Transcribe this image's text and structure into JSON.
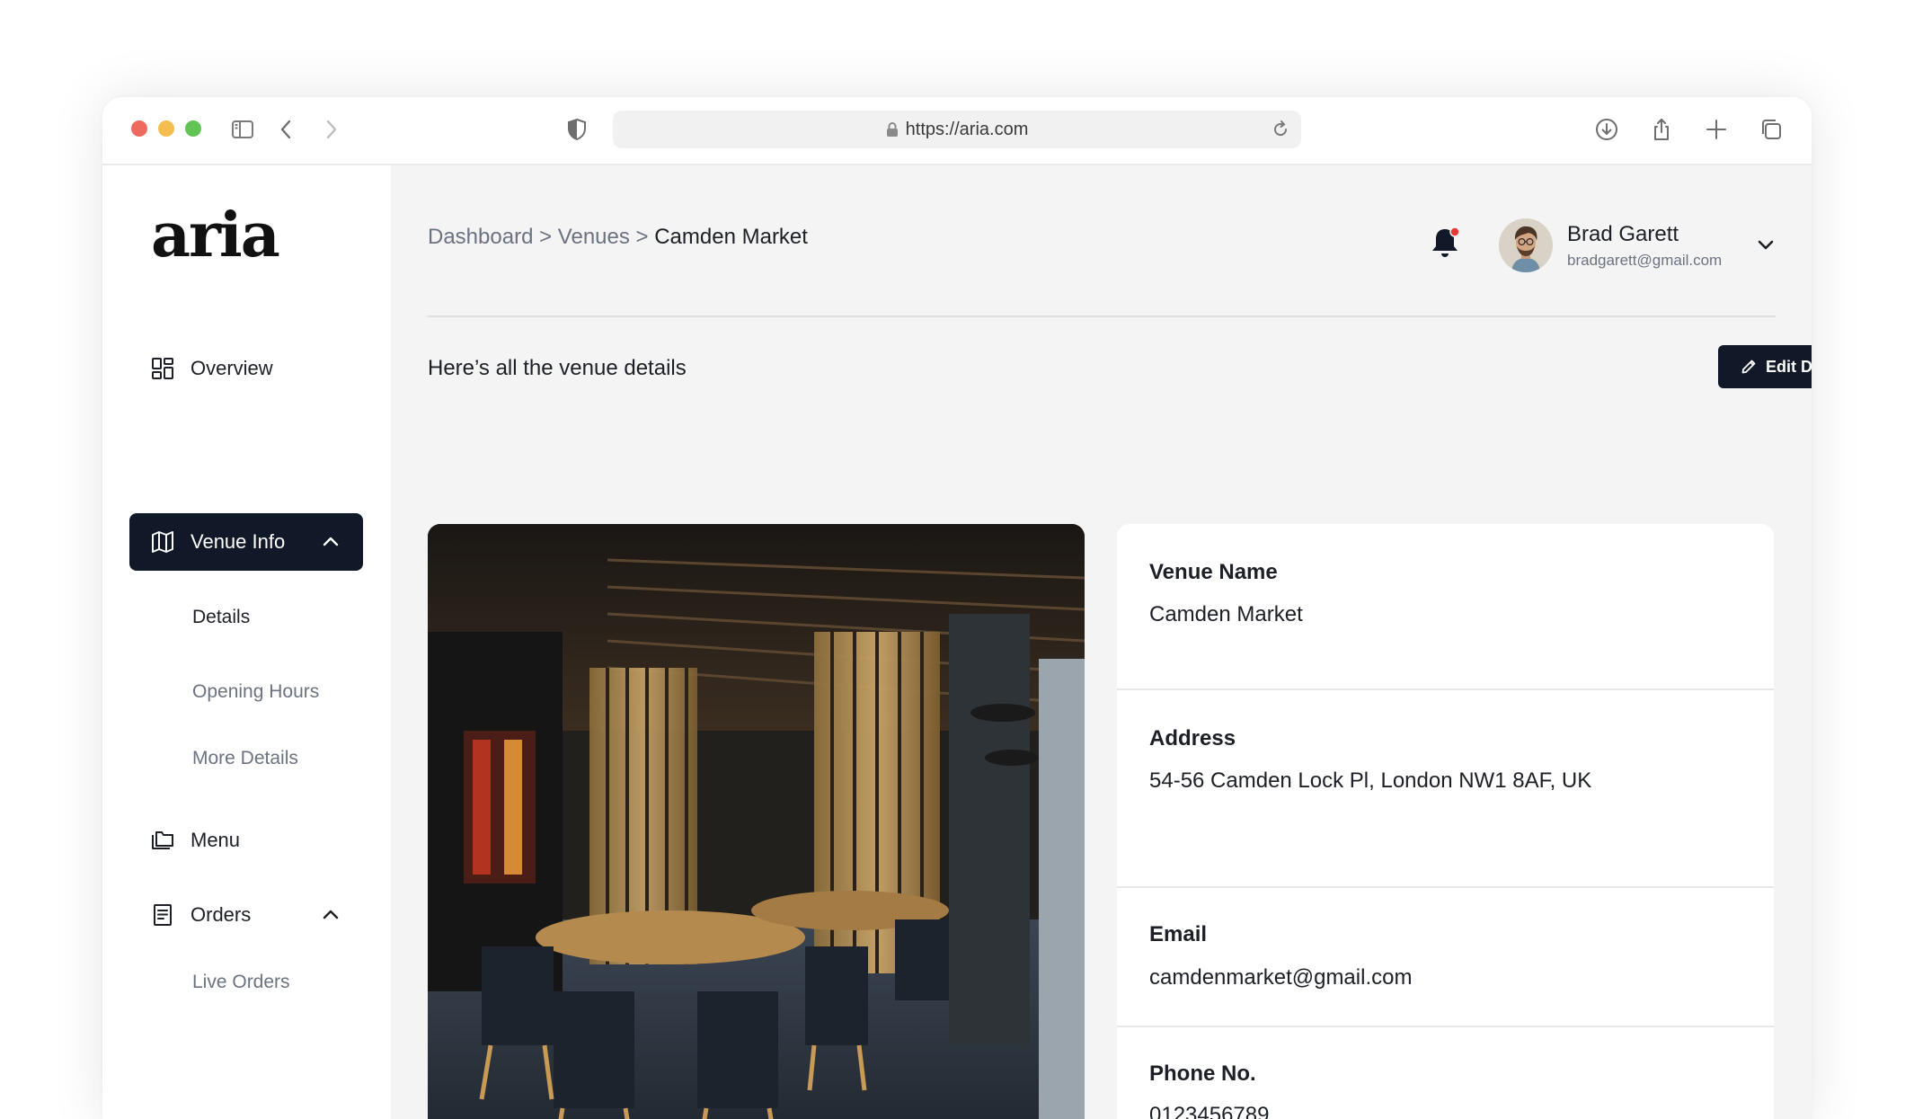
{
  "browser": {
    "url": "https://aria.com"
  },
  "sidebar": {
    "logo": "aria",
    "items": [
      {
        "label": "Overview",
        "icon": "grid-icon"
      },
      {
        "label": "Venue Info",
        "icon": "map-icon",
        "active": true
      },
      {
        "label": "Menu",
        "icon": "folder-icon"
      },
      {
        "label": "Orders",
        "icon": "receipt-icon"
      }
    ],
    "venue_sub": [
      "Details",
      "Opening Hours",
      "More Details"
    ],
    "orders_sub": [
      "Live Orders"
    ]
  },
  "header": {
    "breadcrumb": [
      "Dashboard",
      "Venues",
      "Camden Market"
    ],
    "separator": ">",
    "user": {
      "name": "Brad Garett",
      "email": "bradgarett@gmail.com"
    }
  },
  "content": {
    "subtitle": "Here’s all the venue details",
    "edit_label": "Edit Details",
    "fields": [
      {
        "label": "Venue Name",
        "value": "Camden Market"
      },
      {
        "label": "Address",
        "value": "54-56 Camden Lock Pl, London NW1 8AF, UK"
      },
      {
        "label": "Email",
        "value": "camdenmarket@gmail.com"
      },
      {
        "label": "Phone No.",
        "value": "0123456789"
      }
    ]
  },
  "colors": {
    "accent": "#111827",
    "notification_dot": "#e53935"
  }
}
